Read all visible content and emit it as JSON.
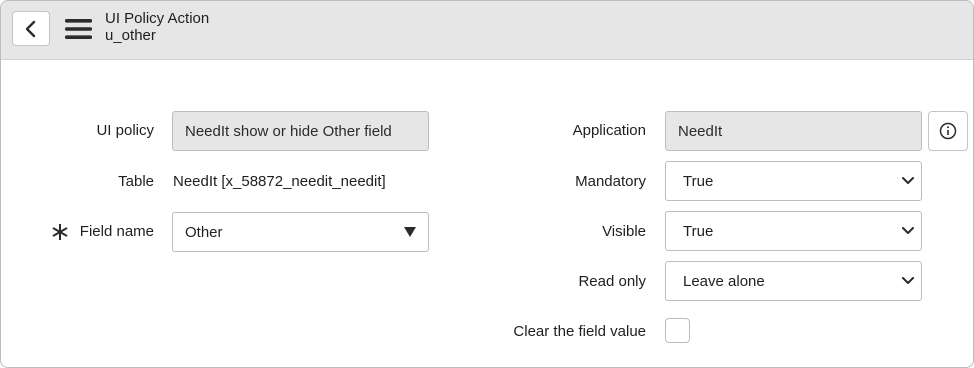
{
  "header": {
    "title": "UI Policy Action",
    "subtitle": "u_other"
  },
  "form": {
    "ui_policy": {
      "label": "UI policy",
      "value": "NeedIt show or hide Other field"
    },
    "table": {
      "label": "Table",
      "value": "NeedIt [x_58872_needit_needit]"
    },
    "field_name": {
      "label": "Field name",
      "value": "Other",
      "required": true
    },
    "application": {
      "label": "Application",
      "value": "NeedIt"
    },
    "mandatory": {
      "label": "Mandatory",
      "value": "True"
    },
    "visible": {
      "label": "Visible",
      "value": "True"
    },
    "read_only": {
      "label": "Read only",
      "value": "Leave alone"
    },
    "clear_field_value": {
      "label": "Clear the field value",
      "checked": false
    }
  },
  "icons": {
    "back": "chevron-left-icon",
    "menu": "hamburger-menu-icon",
    "info": "info-circle-icon",
    "required": "asterisk-icon",
    "dropdown_triangle": "triangle-down-icon",
    "dropdown_chevron": "chevron-down-icon"
  },
  "colors": {
    "header_bg": "#e6e6e6",
    "readonly_bg": "#e6e6e6",
    "border": "#bdbdbd",
    "text": "#1f1f1f"
  }
}
